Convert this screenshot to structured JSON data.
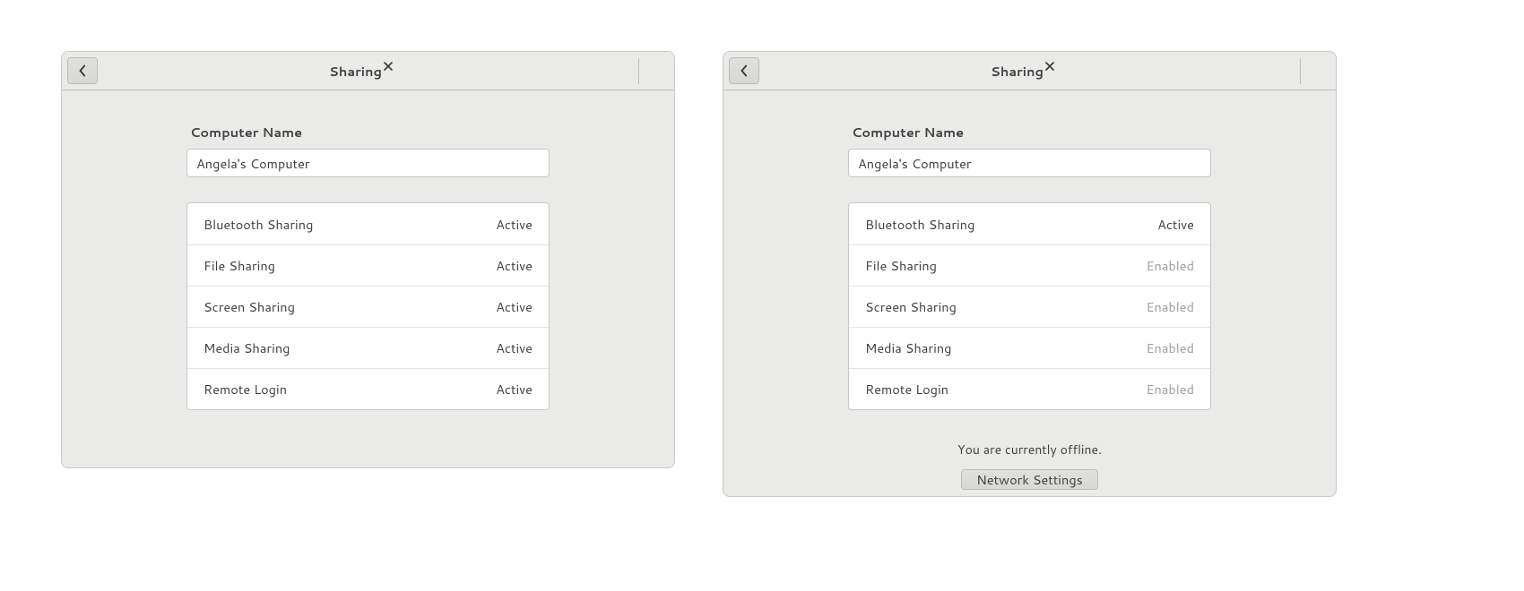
{
  "windows": [
    {
      "id": "left",
      "title": "Sharing",
      "computer_name_label": "Computer Name",
      "computer_name_value": "Angela's Computer",
      "rows": [
        {
          "label": "Bluetooth Sharing",
          "status": "Active",
          "status_class": "status-active"
        },
        {
          "label": "File Sharing",
          "status": "Active",
          "status_class": "status-active"
        },
        {
          "label": "Screen Sharing",
          "status": "Active",
          "status_class": "status-active"
        },
        {
          "label": "Media Sharing",
          "status": "Active",
          "status_class": "status-active"
        },
        {
          "label": "Remote Login",
          "status": "Active",
          "status_class": "status-active"
        }
      ],
      "offline": false,
      "offline_message": "",
      "network_button": ""
    },
    {
      "id": "right",
      "title": "Sharing",
      "computer_name_label": "Computer Name",
      "computer_name_value": "Angela's Computer",
      "rows": [
        {
          "label": "Bluetooth Sharing",
          "status": "Active",
          "status_class": "status-active"
        },
        {
          "label": "File Sharing",
          "status": "Enabled",
          "status_class": "status-enabled"
        },
        {
          "label": "Screen Sharing",
          "status": "Enabled",
          "status_class": "status-enabled"
        },
        {
          "label": "Media Sharing",
          "status": "Enabled",
          "status_class": "status-enabled"
        },
        {
          "label": "Remote Login",
          "status": "Enabled",
          "status_class": "status-enabled"
        }
      ],
      "offline": true,
      "offline_message": "You are currently offline.",
      "network_button": "Network Settings"
    }
  ]
}
